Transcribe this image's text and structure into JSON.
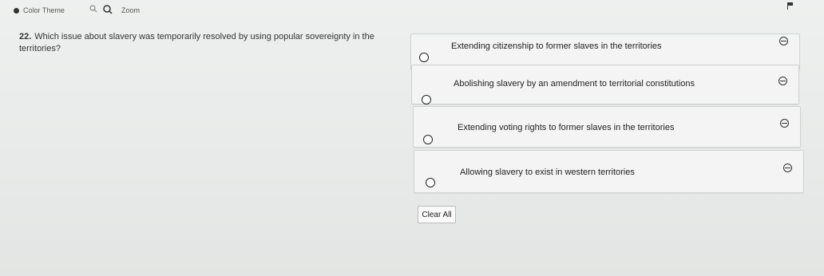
{
  "toolbar": {
    "color_theme_label": "Color Theme",
    "zoom_label": "Zoom"
  },
  "question": {
    "number": "22.",
    "text": "Which issue about slavery was temporarily resolved by using popular sovereignty in the territories?"
  },
  "options": [
    {
      "label": "Extending citizenship to former slaves in the territories"
    },
    {
      "label": "Abolishing slavery by an amendment to territorial constitutions"
    },
    {
      "label": "Extending voting rights to former slaves in the territories"
    },
    {
      "label": "Allowing slavery to exist in western territories"
    }
  ],
  "clear_all_label": "Clear All",
  "icons": {
    "color_theme": "color-theme-icon",
    "zoom_out": "zoom-out-icon",
    "zoom_in": "zoom-in-icon",
    "flag": "flag-icon",
    "eliminate": "eliminate-option-icon"
  }
}
